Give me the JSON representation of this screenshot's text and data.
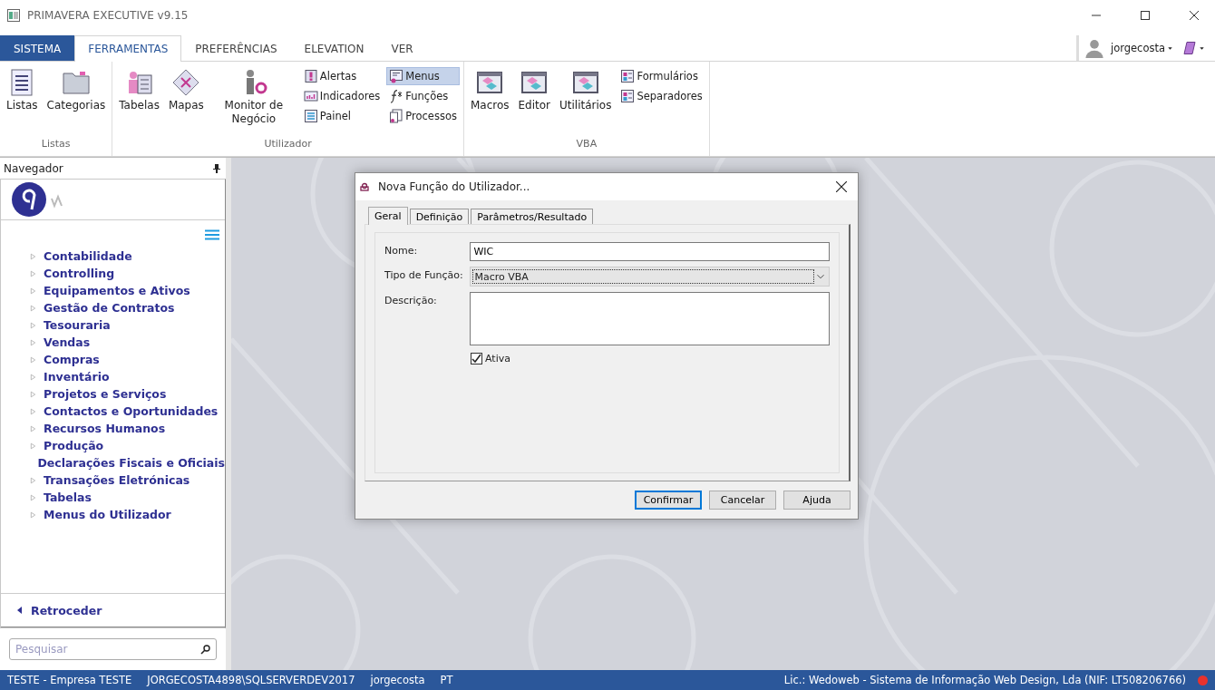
{
  "window": {
    "title": "PRIMAVERA EXECUTIVE v9.15"
  },
  "menu_tabs": [
    {
      "label": "SISTEMA",
      "kind": "app",
      "selected": false
    },
    {
      "label": "FERRAMENTAS",
      "kind": "tab",
      "selected": true
    },
    {
      "label": "PREFERÊNCIAS",
      "kind": "tab",
      "selected": false
    },
    {
      "label": "ELEVATION",
      "kind": "tab",
      "selected": false
    },
    {
      "label": "VER",
      "kind": "tab",
      "selected": false
    }
  ],
  "user": {
    "name": "jorgecosta"
  },
  "ribbon_groups": [
    {
      "label": "Listas",
      "items": [
        {
          "label": "Listas",
          "kind": "large",
          "selected": false
        },
        {
          "label": "Categorias",
          "kind": "large",
          "selected": false
        }
      ]
    },
    {
      "label": "Utilizador",
      "items": [
        {
          "label": "Tabelas",
          "kind": "large",
          "selected": false
        },
        {
          "label": "Mapas",
          "kind": "large",
          "selected": false
        },
        {
          "label": "Monitor de Negócio",
          "kind": "large",
          "selected": false
        },
        {
          "label": "Alertas",
          "kind": "small",
          "selected": false
        },
        {
          "label": "Indicadores",
          "kind": "small",
          "selected": false
        },
        {
          "label": "Painel",
          "kind": "small",
          "selected": false
        },
        {
          "label": "Menus",
          "kind": "small",
          "selected": true
        },
        {
          "label": "Funções",
          "kind": "small",
          "selected": false
        },
        {
          "label": "Processos",
          "kind": "small",
          "selected": false
        }
      ]
    },
    {
      "label": "VBA",
      "items": [
        {
          "label": "Macros",
          "kind": "large",
          "selected": false
        },
        {
          "label": "Editor",
          "kind": "large",
          "selected": false
        },
        {
          "label": "Utilitários",
          "kind": "large",
          "selected": false
        },
        {
          "label": "Formulários",
          "kind": "small",
          "selected": false
        },
        {
          "label": "Separadores",
          "kind": "small",
          "selected": false
        }
      ]
    }
  ],
  "navigator": {
    "title": "Navegador",
    "items": [
      "Contabilidade",
      "Controlling",
      "Equipamentos e Ativos",
      "Gestão de Contratos",
      "Tesouraria",
      "Vendas",
      "Compras",
      "Inventário",
      "Projetos e Serviços",
      "Contactos e Oportunidades",
      "Recursos Humanos",
      "Produção",
      "Declarações Fiscais e Oficiais",
      "Transações Eletrónicas",
      "Tabelas",
      "Menus do Utilizador"
    ],
    "back": "Retroceder",
    "search": {
      "placeholder": "Pesquisar"
    }
  },
  "dialog": {
    "title": "Nova Função do Utilizador...",
    "tabs": [
      {
        "label": "Geral",
        "selected": true
      },
      {
        "label": "Definição",
        "selected": false
      },
      {
        "label": "Parâmetros/Resultado",
        "selected": false
      }
    ],
    "fields": [
      {
        "label": "Nome:",
        "kind": "text",
        "value": "WIC"
      },
      {
        "label": "Tipo de Função:",
        "kind": "select",
        "value": "Macro VBA"
      },
      {
        "label": "Descrição:",
        "kind": "textarea"
      }
    ],
    "active": {
      "label": "Ativa",
      "checked": true
    },
    "buttons": [
      {
        "label": "Confirmar",
        "default": true
      },
      {
        "label": "Cancelar",
        "default": false
      },
      {
        "label": "Ajuda",
        "default": false
      }
    ]
  },
  "status_bar": {
    "left": [
      "TESTE - Empresa TESTE",
      "JORGECOSTA4898\\SQLSERVERDEV2017",
      "jorgecosta",
      "PT"
    ],
    "right": "Lic.: Wedoweb - Sistema de Informação Web Design, Lda (NIF: LT508206766)"
  }
}
